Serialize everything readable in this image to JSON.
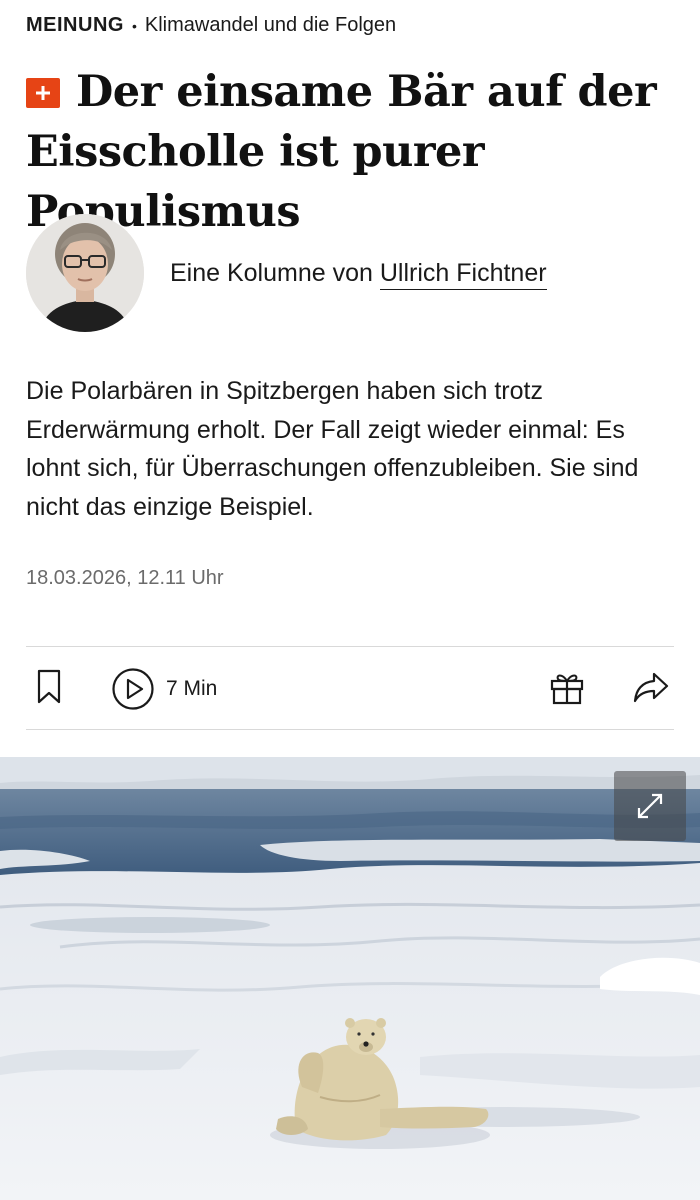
{
  "kicker": {
    "section": "MEINUNG",
    "separator": "•",
    "topic": "Klimawandel und die Folgen"
  },
  "headline": {
    "badge_icon": "plus-icon",
    "badge_color": "#e64415",
    "line1": "Der einsame Bär auf der",
    "line2": "Eisscholle ist purer Populismus"
  },
  "author": {
    "prefix": "Eine Kolumne von ",
    "name": "Ullrich Fichtner"
  },
  "teaser": "Die Polarbären in Spitzbergen haben sich trotz Erderwärmung erholt. Der Fall zeigt wieder einmal: Es lohnt sich, für Überraschungen offenzubleiben. Sie sind nicht das einzige Beispiel.",
  "date": "18.03.2026, 12.11 Uhr",
  "toolbar": {
    "bookmark_icon": "bookmark-icon",
    "listen_icon": "play-circle-icon",
    "listen_label": "7 Min",
    "gift_icon": "gift-icon",
    "share_icon": "share-icon"
  },
  "hero": {
    "expand_icon": "expand-icon"
  }
}
